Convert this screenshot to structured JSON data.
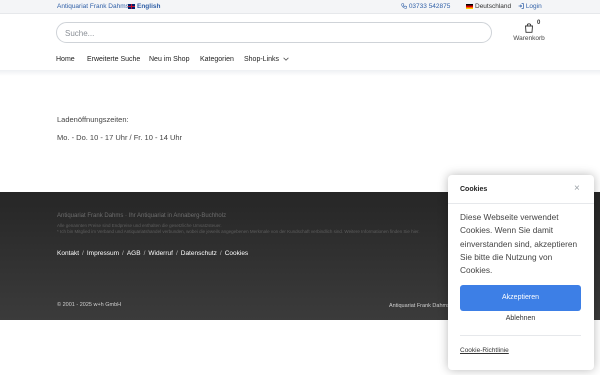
{
  "topbar": {
    "shop_name": "Antiquariat Frank Dahms",
    "language_alt": "English",
    "phone": "03733 542875",
    "language_current": "Deutschland",
    "login": "Login"
  },
  "header": {
    "search_placeholder": "Suche...",
    "cart_count": "0",
    "cart_label": "Warenkorb"
  },
  "nav": {
    "items": [
      "Home",
      "Erweiterte Suche",
      "Neu im Shop",
      "Kategorien",
      "Shop-Links"
    ]
  },
  "main": {
    "hours_title": "Ladenöffnungszeiten:",
    "hours_text": "Mo. - Do. 10 - 17 Uhr / Fr. 10 - 14 Uhr"
  },
  "footer": {
    "company": "Antiquariat Frank Dahms · Ihr Antiquariat in Annaberg-Buchholz",
    "note_1": "Alle genannten Preise sind Endpreise und enthalten die gesetzliche Umsatzsteuer.",
    "note_2": "* Ich bin Mitglied im Verband und Antiquariatshandel verbunden, wobei die jeweils angegebenen Merkmale von der Kundschaft verbindlich sind. Weitere Informationen finden Sie hier.",
    "links": [
      "Kontakt",
      "Impressum",
      "AGB",
      "Widerruf",
      "Datenschutz",
      "Cookies"
    ],
    "copyright": "© 2001 - 2025 w+h GmbH",
    "right_text": "Antiquariat Frank Dahms"
  },
  "cookie": {
    "title": "Cookies",
    "body": "Diese Webseite verwendet Cookies. Wenn Sie damit einverstanden sind, akzeptieren Sie bitte die Nutzung von Cookies.",
    "accept": "Akzeptieren",
    "deny": "Ablehnen",
    "policy": "Cookie-Richtlinie"
  },
  "colors": {
    "accent": "#3d7fe6",
    "link": "#2f5fa7",
    "footer_bg": "#2e2e2e"
  }
}
